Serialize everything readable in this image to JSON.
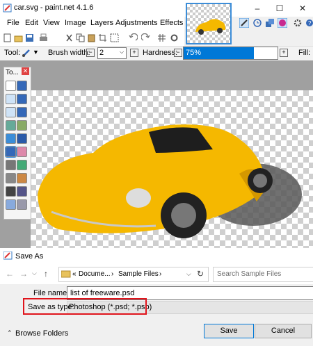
{
  "window": {
    "title": "car.svg - paint.net 4.1.6",
    "minimize": "–",
    "maximize": "☐",
    "close": "✕"
  },
  "menu": [
    "File",
    "Edit",
    "View",
    "Image",
    "Layers",
    "Adjustments",
    "Effects"
  ],
  "tool_options": {
    "tool_label": "Tool:",
    "brush_width_label": "Brush width:",
    "brush_width_value": "2",
    "hardness_label": "Hardness:",
    "hardness_value": "75%",
    "hardness_percent": 75,
    "fill_label": "Fill:"
  },
  "tools_palette": {
    "title": "To..."
  },
  "dialog": {
    "title": "Save As",
    "breadcrumb_prefix": "«",
    "breadcrumb": [
      "Docume...",
      "Sample Files"
    ],
    "search_placeholder": "Search Sample Files",
    "file_name_label": "File name:",
    "file_name_value": "list of freeware.psd",
    "save_type_label": "Save as type:",
    "save_type_value": "Photoshop (*.psd; *.psb)",
    "browse_folders": "Browse Folders",
    "save": "Save",
    "cancel": "Cancel"
  },
  "colors": {
    "accent": "#0078d7",
    "highlight": "#e0141c",
    "car": "#f5b800"
  }
}
